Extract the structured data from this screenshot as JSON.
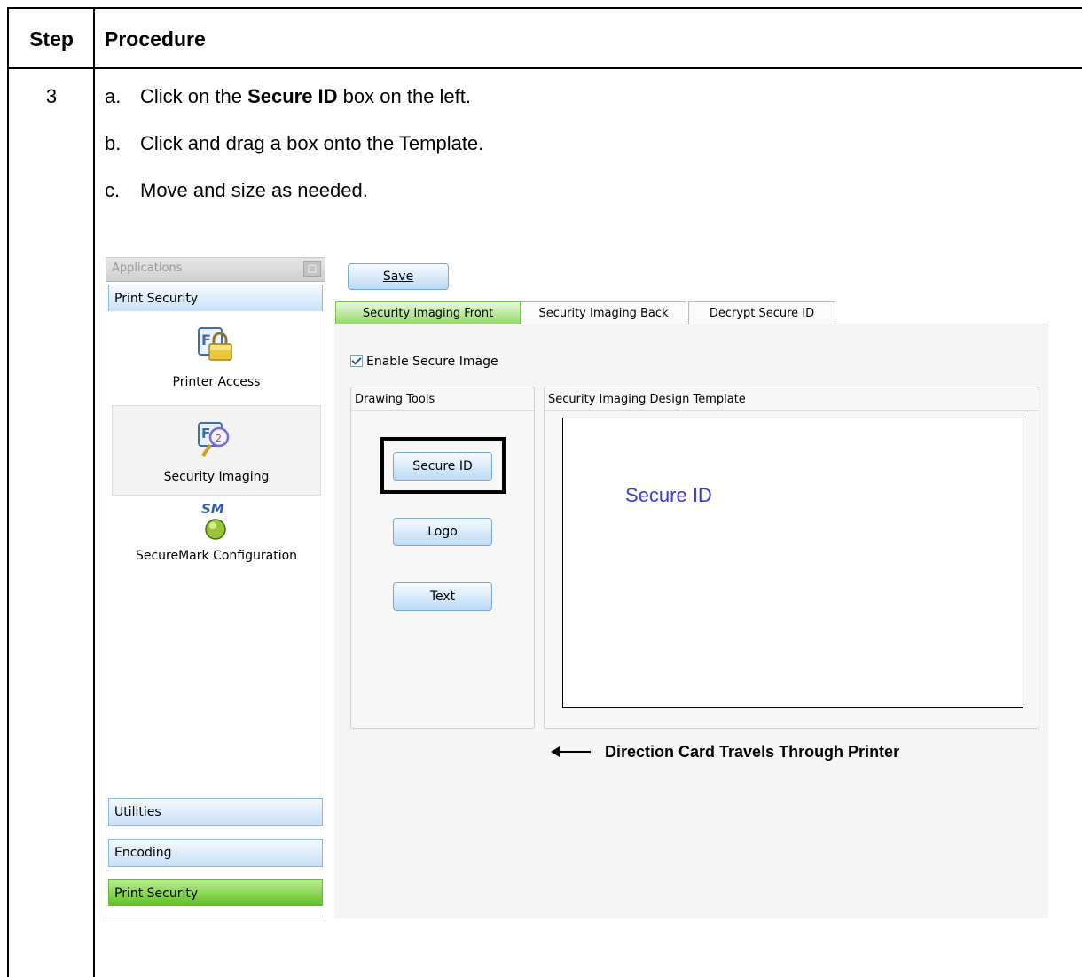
{
  "table": {
    "header_step": "Step",
    "header_procedure": "Procedure",
    "step_number": "3",
    "instructions": [
      {
        "letter": "a.",
        "pre": "Click on the ",
        "bold": "Secure ID",
        "post": " box on the left."
      },
      {
        "letter": "b.",
        "text": "Click and drag a box onto the Template."
      },
      {
        "letter": "c.",
        "text": "Move and size as needed."
      }
    ]
  },
  "screenshot": {
    "applications_panel": {
      "title": "Applications",
      "pin_icon": "pin-icon",
      "top_category": "Print Security",
      "items": [
        {
          "label": "Printer Access",
          "icon": "padlock-card-icon"
        },
        {
          "label": "Security Imaging",
          "icon": "magnifier-card-icon"
        },
        {
          "label": "SecureMark Configuration",
          "icon": "securemark-icon",
          "icon_text": "SM"
        }
      ],
      "bottom_categories": [
        "Utilities",
        "Encoding",
        "Print Security"
      ]
    },
    "save_button": "Save",
    "tabs": [
      "Security Imaging Front",
      "Security Imaging Back",
      "Decrypt Secure ID"
    ],
    "active_tab": "Security Imaging Front",
    "enable_checkbox": {
      "label": "Enable Secure Image",
      "checked": true
    },
    "drawing_tools": {
      "title": "Drawing Tools",
      "buttons": [
        "Secure ID",
        "Logo",
        "Text"
      ],
      "highlighted": "Secure ID"
    },
    "template": {
      "title": "Security Imaging Design Template",
      "placed_text": "Secure ID"
    },
    "direction_label": "Direction Card Travels Through Printer",
    "colors": {
      "tab_active": "#8fd85e",
      "button_blue": "#bcdbf6",
      "placed_text": "#3a3ad6"
    }
  }
}
